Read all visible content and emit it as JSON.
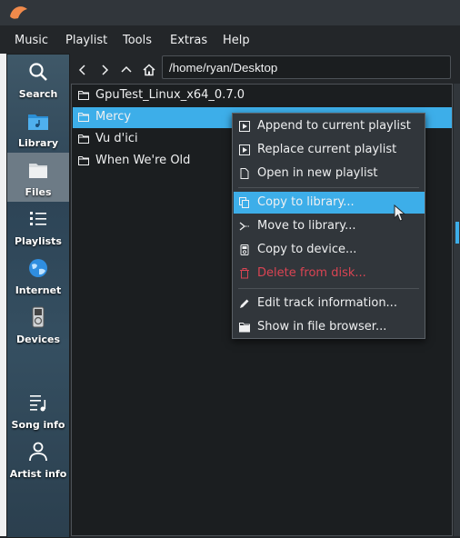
{
  "menubar": {
    "items": [
      {
        "label": "Music"
      },
      {
        "label": "Playlist"
      },
      {
        "label": "Tools"
      },
      {
        "label": "Extras"
      },
      {
        "label": "Help"
      }
    ]
  },
  "sidebar": {
    "items": [
      {
        "label": "Search",
        "icon": "search-icon"
      },
      {
        "label": "Library",
        "icon": "library-folder-icon"
      },
      {
        "label": "Files",
        "icon": "folder-icon",
        "active": true
      },
      {
        "label": "Playlists",
        "icon": "playlist-icon"
      },
      {
        "label": "Internet",
        "icon": "globe-icon"
      },
      {
        "label": "Devices",
        "icon": "media-player-icon"
      },
      {
        "label": "Song info",
        "icon": "song-info-icon"
      },
      {
        "label": "Artist info",
        "icon": "person-icon"
      }
    ]
  },
  "path": {
    "value": "/home/ryan/Desktop"
  },
  "files": [
    {
      "name": "GpuTest_Linux_x64_0.7.0",
      "selected": false
    },
    {
      "name": "Mercy",
      "selected": true
    },
    {
      "name": "Vu d'ici",
      "selected": false
    },
    {
      "name": "When We're Old",
      "selected": false
    }
  ],
  "context_menu": {
    "items": [
      {
        "label": "Append to current playlist",
        "icon": "play-document-icon"
      },
      {
        "label": "Replace current playlist",
        "icon": "play-document-icon"
      },
      {
        "label": "Open in new playlist",
        "icon": "document-icon"
      },
      {
        "label": "Copy to library...",
        "icon": "copy-icon",
        "highlighted": true
      },
      {
        "label": "Move to library...",
        "icon": "move-icon"
      },
      {
        "label": "Copy to device...",
        "icon": "device-icon"
      },
      {
        "label": "Delete from disk...",
        "icon": "trash-icon",
        "color": "#da4453"
      },
      {
        "label": "Edit track information...",
        "icon": "pencil-icon"
      },
      {
        "label": "Show in file browser...",
        "icon": "folder-icon"
      }
    ]
  },
  "colors": {
    "accent": "#3daee9",
    "background": "#232629",
    "list_background": "#1b1e20"
  }
}
